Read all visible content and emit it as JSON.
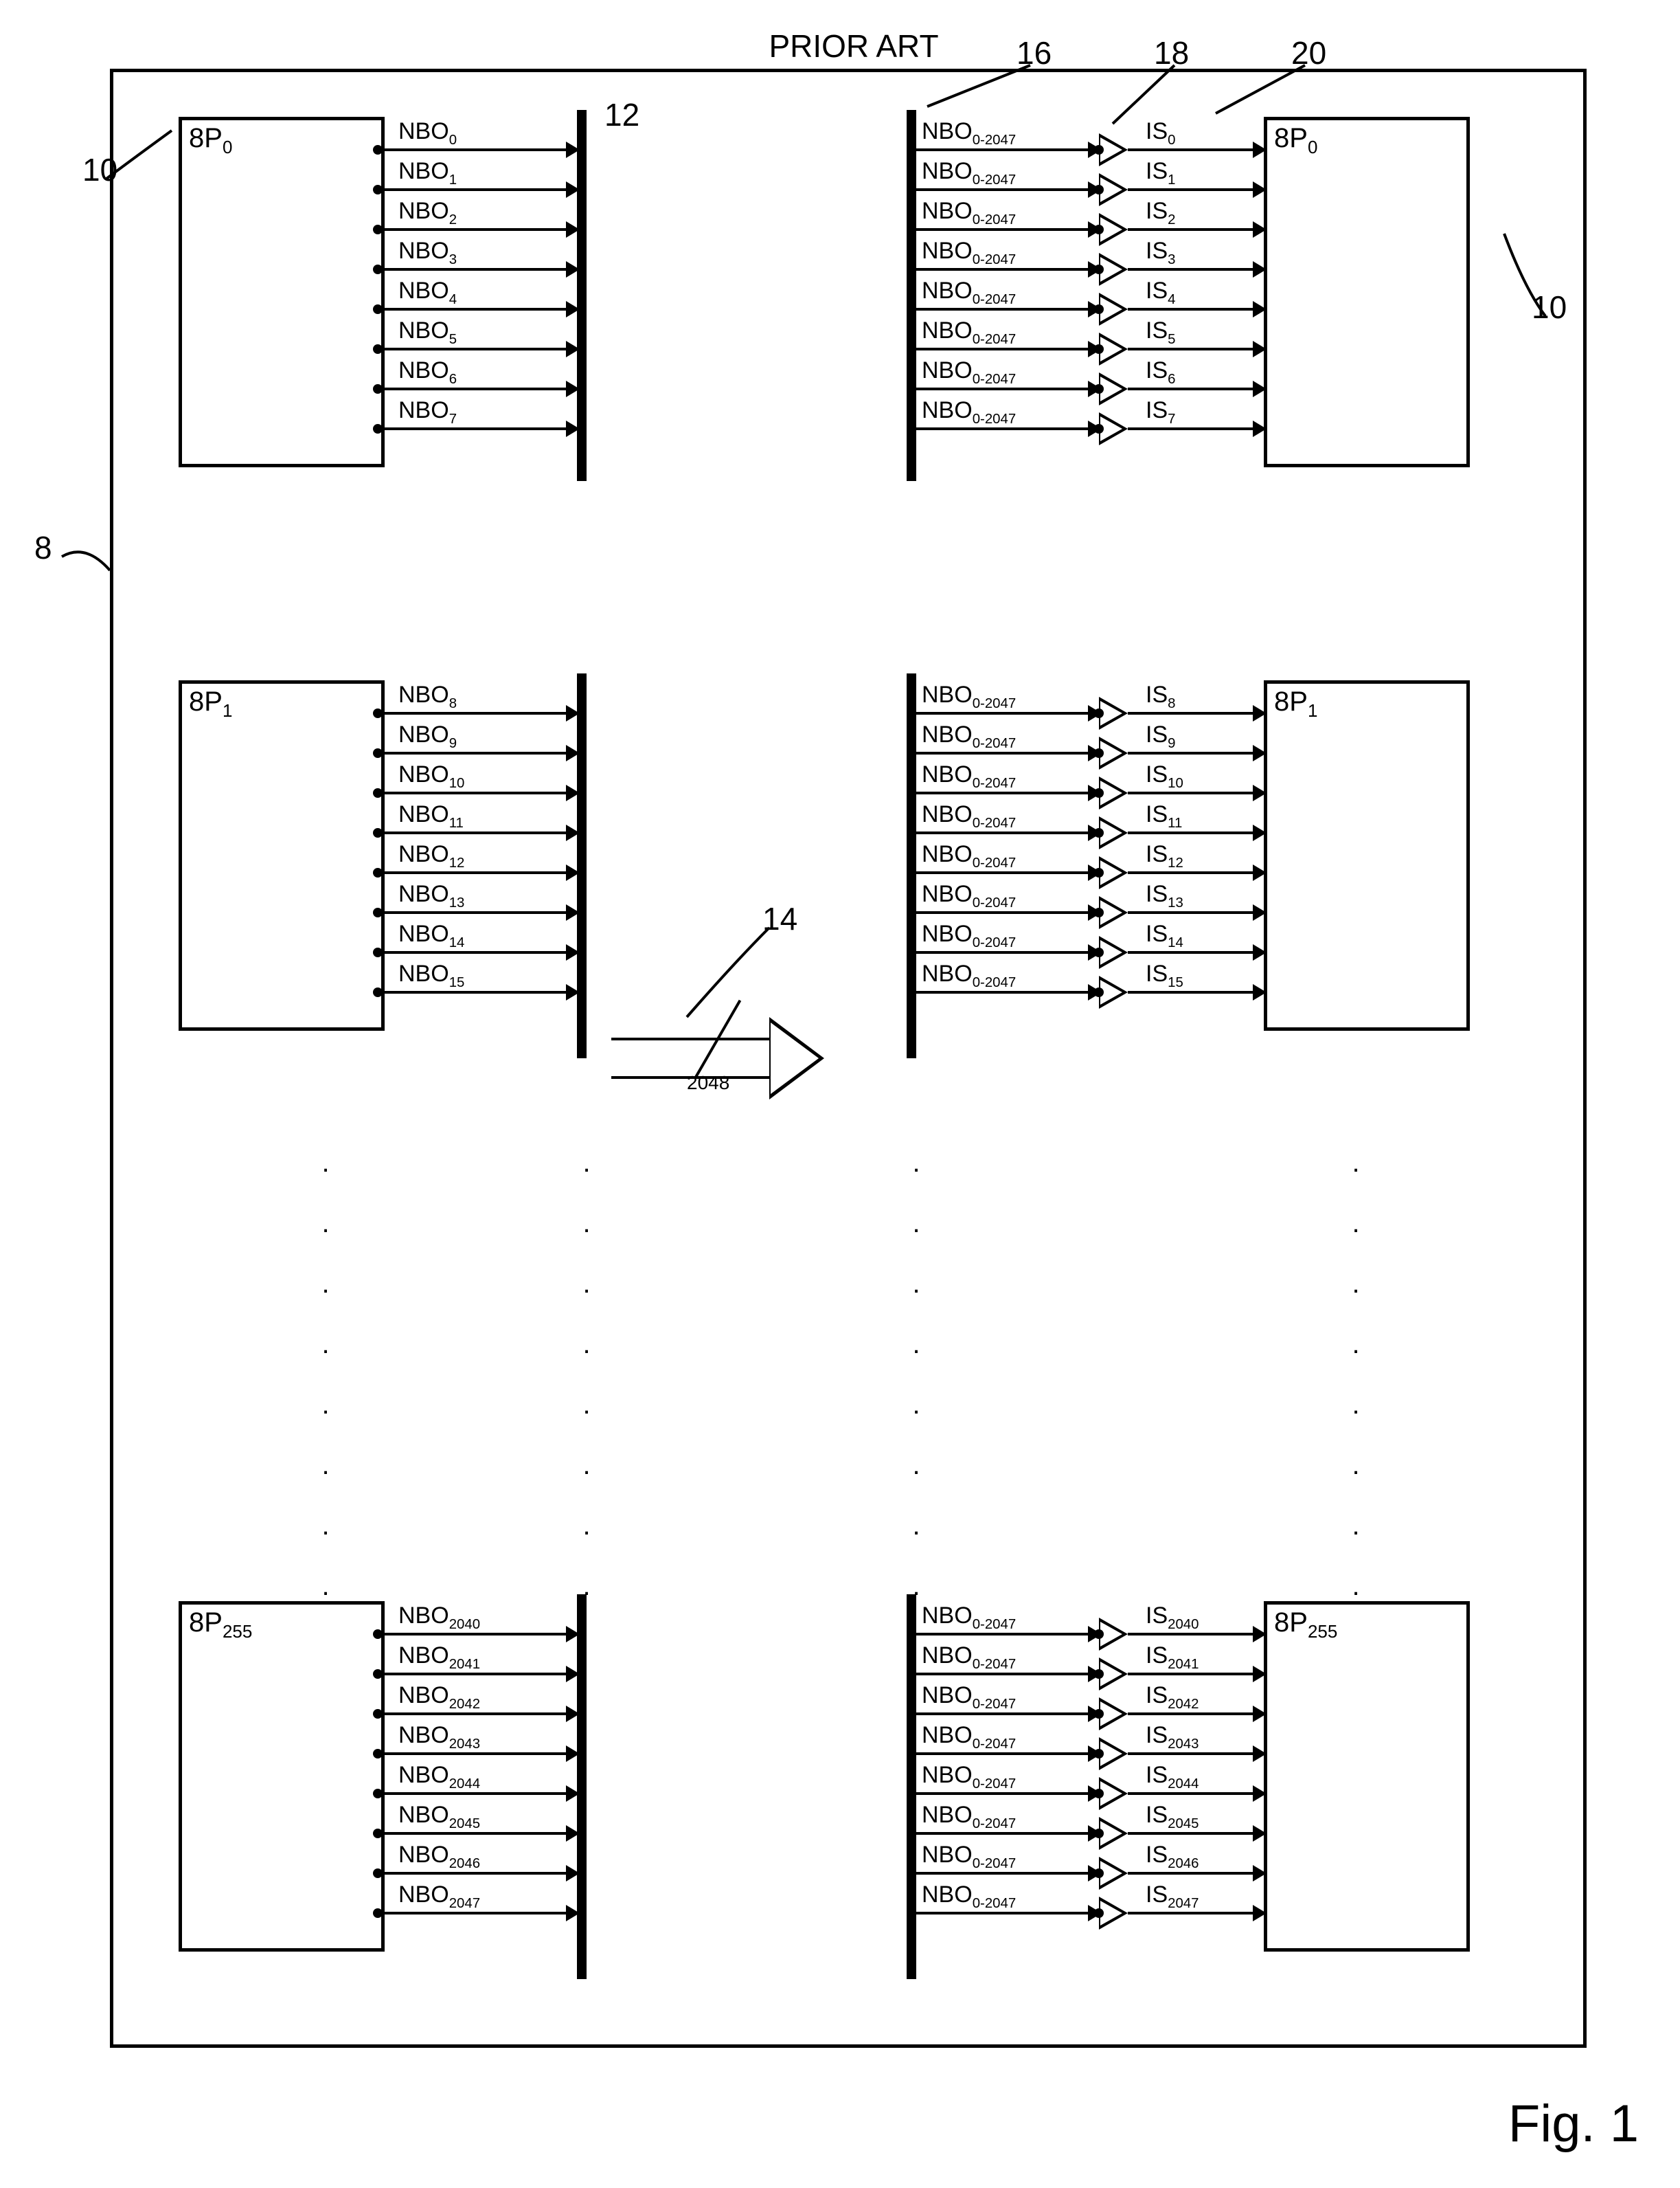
{
  "title": "PRIOR ART",
  "figure": "Fig. 1",
  "refs": {
    "r8": "8",
    "r10a": "10",
    "r10b": "10",
    "r12": "12",
    "r14": "14",
    "r16": "16",
    "r18": "18",
    "r20": "20"
  },
  "bus_count": "2048",
  "input_bus_label": "NBO",
  "input_bus_sub": "0-2047",
  "leftBlocks": [
    {
      "id": "8P0",
      "label": "8P",
      "sub": "0",
      "signals": [
        "0",
        "1",
        "2",
        "3",
        "4",
        "5",
        "6",
        "7"
      ]
    },
    {
      "id": "8P1",
      "label": "8P",
      "sub": "1",
      "signals": [
        "8",
        "9",
        "10",
        "11",
        "12",
        "13",
        "14",
        "15"
      ]
    },
    {
      "id": "8P255",
      "label": "8P",
      "sub": "255",
      "signals": [
        "2040",
        "2041",
        "2042",
        "2043",
        "2044",
        "2045",
        "2046",
        "2047"
      ]
    }
  ],
  "rightBlocks": [
    {
      "id": "8P0r",
      "label": "8P",
      "sub": "0",
      "signals": [
        "0",
        "1",
        "2",
        "3",
        "4",
        "5",
        "6",
        "7"
      ]
    },
    {
      "id": "8P1r",
      "label": "8P",
      "sub": "1",
      "signals": [
        "8",
        "9",
        "10",
        "11",
        "12",
        "13",
        "14",
        "15"
      ]
    },
    {
      "id": "8P255r",
      "label": "8P",
      "sub": "255",
      "signals": [
        "2040",
        "2041",
        "2042",
        "2043",
        "2044",
        "2045",
        "2046",
        "2047"
      ]
    }
  ],
  "left_signal_prefix": "NBO",
  "right_signal_prefix": "IS"
}
